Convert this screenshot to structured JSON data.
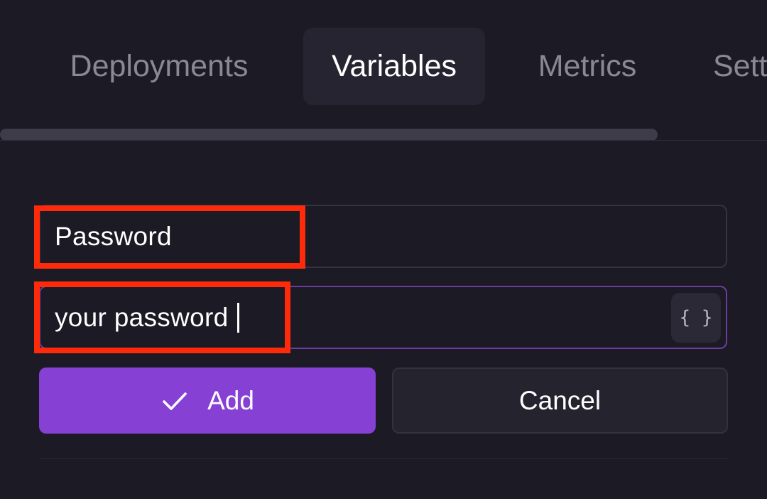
{
  "tabs": {
    "deployments": "Deployments",
    "variables": "Variables",
    "metrics": "Metrics",
    "settings": "Sett"
  },
  "form": {
    "name_value": "Password",
    "value_value": "your password",
    "braces_label": "{ }",
    "add_label": "Add",
    "cancel_label": "Cancel"
  },
  "icons": {
    "add": "check-icon",
    "reference": "braces-icon"
  },
  "colors": {
    "background": "#1b1a25",
    "accent": "#8640d4",
    "focus_border": "#6b3d9e",
    "highlight": "#ff2a0a"
  }
}
